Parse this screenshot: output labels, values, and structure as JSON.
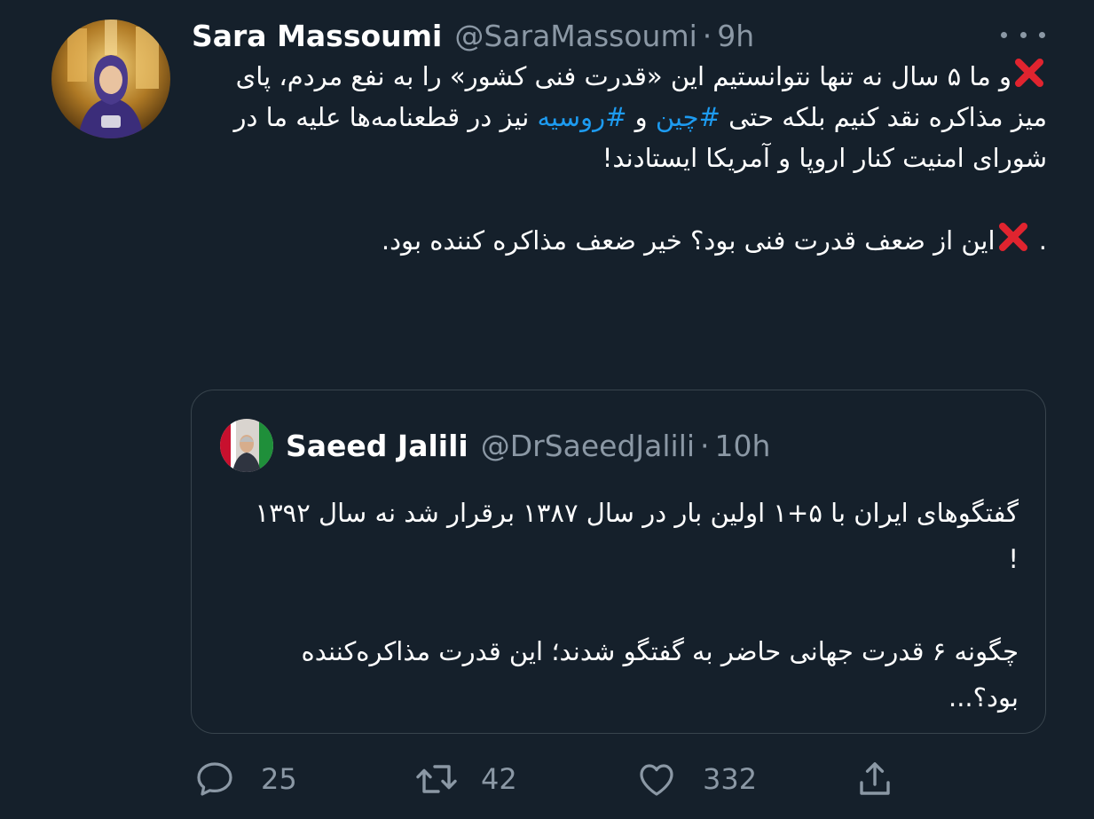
{
  "tweet": {
    "author_name": "Sara Massoumi",
    "author_handle": "@SaraMassoumi",
    "separator": "·",
    "time": "9h",
    "body": [
      [
        {
          "t": "x"
        },
        {
          "t": "text",
          "v": "و ما ۵ سال نه تنها نتوانستیم این «قدرت فنی کشور» را به نفع مردم، پای میز مذاکره نقد کنیم بلکه حتی "
        },
        {
          "t": "tag",
          "v": "#چین"
        },
        {
          "t": "text",
          "v": " و "
        },
        {
          "t": "tag",
          "v": "#روسیه"
        },
        {
          "t": "text",
          "v": " نیز در قطعنامه‌ها علیه ما در شورای امنیت کنار اروپا و آمریکا ایستادند!"
        }
      ],
      [],
      [
        {
          "t": "text",
          "v": ". "
        },
        {
          "t": "x"
        },
        {
          "t": "text",
          "v": "این از ضعف قدرت فنی بود؟ خیر ضعف مذاکره کننده بود."
        }
      ]
    ]
  },
  "quoted": {
    "author_name": "Saeed Jalili",
    "author_handle": "@DrSaeedJalili",
    "separator": "·",
    "time": "10h",
    "paragraphs": [
      "گفتگوهای ایران با ۵+۱ اولین بار در سال ۱۳۸۷ برقرار شد نه سال ۱۳۹۲ !",
      "",
      "چگونه ۶ قدرت جهانی حاضر به گفتگو شدند؛ این قدرت مذاکره‌کننده بود؟..."
    ]
  },
  "actions": {
    "reply_count": "25",
    "retweet_count": "42",
    "like_count": "332"
  },
  "colors": {
    "background": "#15202b",
    "secondary_text": "#8b98a5",
    "hashtag": "#1d9bf0",
    "x_mark": "#e0242f",
    "border": "#38444d"
  },
  "icons": {
    "more": "more-horizontal-icon",
    "x_mark": "cross-mark-icon",
    "reply": "reply-icon",
    "retweet": "retweet-icon",
    "like": "heart-icon",
    "share": "share-icon"
  }
}
